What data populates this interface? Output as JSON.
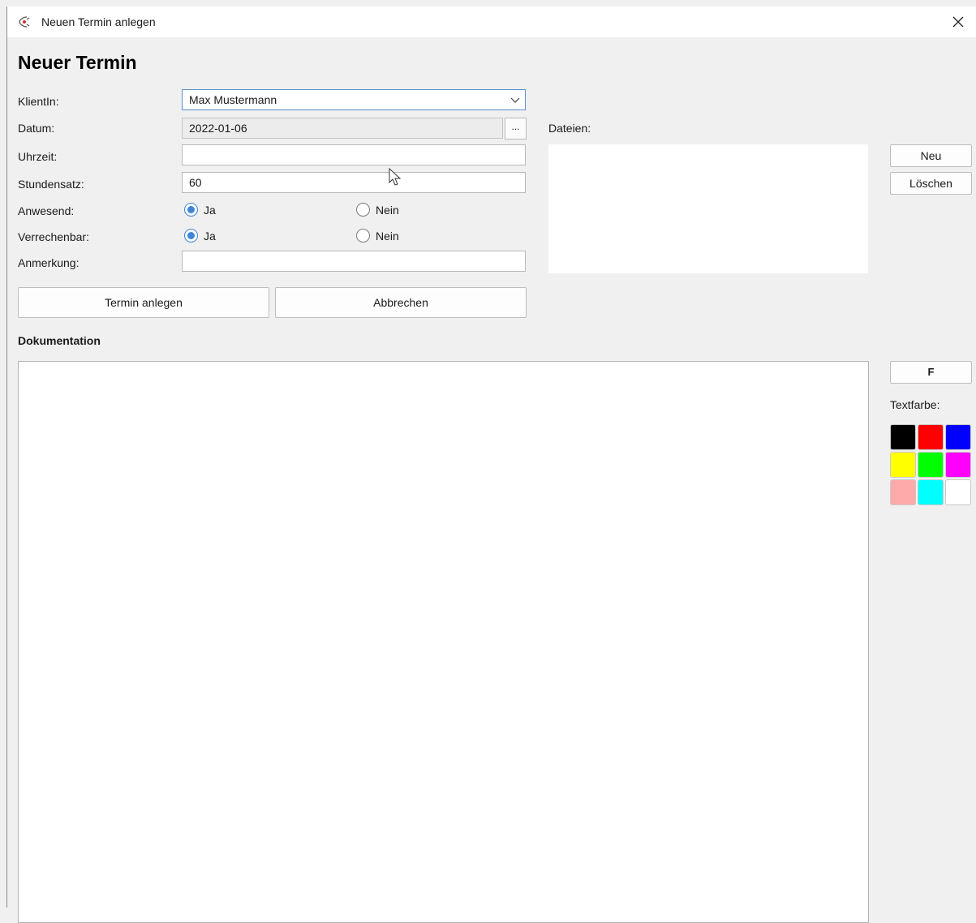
{
  "window": {
    "title": "Neuen Termin anlegen"
  },
  "heading": "Neuer Termin",
  "form": {
    "client_label": "KlientIn:",
    "client_value": "Max Mustermann",
    "date_label": "Datum:",
    "date_value": "2022-01-06",
    "date_button": "...",
    "time_label": "Uhrzeit:",
    "time_value": "",
    "rate_label": "Stundensatz:",
    "rate_value": "60",
    "present_label": "Anwesend:",
    "billable_label": "Verrechenbar:",
    "yes_label": "Ja",
    "no_label": "Nein",
    "present_selected": "Ja",
    "billable_selected": "Ja",
    "note_label": "Anmerkung:",
    "note_value": ""
  },
  "buttons": {
    "create": "Termin anlegen",
    "cancel": "Abbrechen"
  },
  "files": {
    "label": "Dateien:",
    "new_button": "Neu",
    "delete_button": "Löschen"
  },
  "documentation": {
    "label": "Dokumentation",
    "bold_button": "F",
    "text_color_label": "Textfarbe:",
    "colors": [
      "#000000",
      "#ff0000",
      "#0000ff",
      "#ffff00",
      "#00ff00",
      "#ff00ff",
      "#ffaaaa",
      "#00ffff",
      "#ffffff"
    ]
  }
}
